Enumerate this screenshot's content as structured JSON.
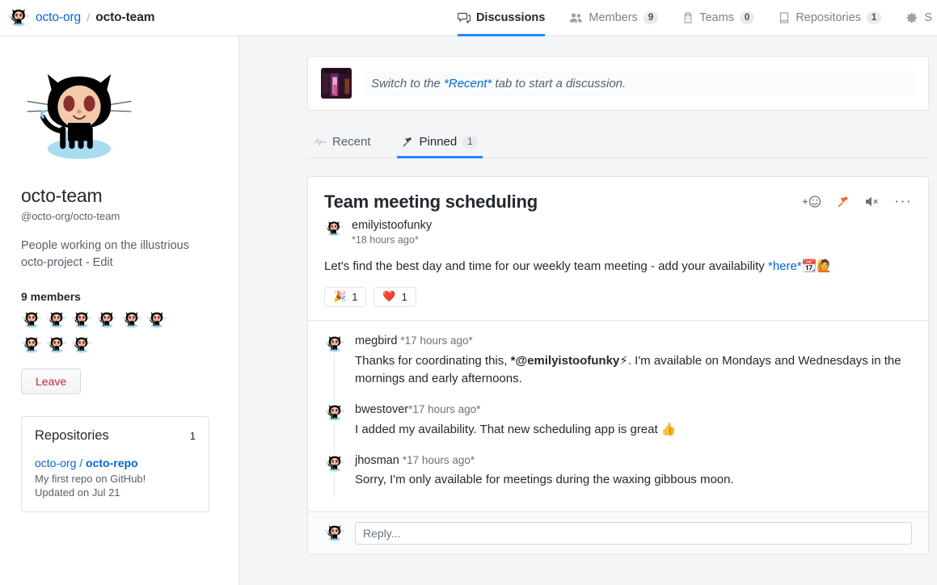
{
  "header": {
    "breadcrumb": {
      "org": "octo-org",
      "separator": "/",
      "team": "octo-team"
    },
    "tabs": [
      {
        "label": "Discussions",
        "count": "",
        "icon": "comment-discussion-icon",
        "active": true
      },
      {
        "label": "Members",
        "count": "9",
        "icon": "people-icon",
        "active": false
      },
      {
        "label": "Teams",
        "count": "0",
        "icon": "organization-icon",
        "active": false
      },
      {
        "label": "Repositories",
        "count": "1",
        "icon": "repo-icon",
        "active": false
      },
      {
        "label": "S",
        "count": "",
        "icon": "gear-icon",
        "active": false
      }
    ]
  },
  "sidebar": {
    "team_name": "octo-team",
    "team_handle": "@octo-org/octo-team",
    "team_description": "People working on the illustrious octo-project - Edit",
    "members_heading": "9 members",
    "member_count": 9,
    "leave_label": "Leave",
    "repositories_card": {
      "title": "Repositories",
      "count": "1",
      "repo_owner": "octo-org",
      "repo_separator": " / ",
      "repo_name": "octo-repo",
      "repo_description": "My first repo on GitHub!",
      "repo_updated": "Updated on Jul 21"
    }
  },
  "main": {
    "composer": {
      "text_before": "Switch to the ",
      "link_text": "*Recent*",
      "text_after": " tab to start a discussion."
    },
    "sub_tabs": [
      {
        "label": "Recent",
        "count": "",
        "icon": "pulse-icon",
        "active": false
      },
      {
        "label": "Pinned",
        "count": "1",
        "icon": "pin-icon",
        "active": true
      }
    ],
    "discussion": {
      "title": "Team meeting scheduling",
      "author": "emilyistoofunky",
      "timestamp": "*18 hours ago*",
      "body_before": "Let's find the best day and time for our weekly team meeting - add your availability ",
      "body_link": "*here*",
      "body_emoji_1": "📆",
      "body_emoji_2": "🙋",
      "actions": [
        {
          "name": "add-reaction-icon",
          "label": "+"
        },
        {
          "name": "pin-icon",
          "label": ""
        },
        {
          "name": "mute-icon",
          "label": ""
        },
        {
          "name": "more-options-icon",
          "label": "···"
        }
      ],
      "reactions": [
        {
          "emoji": "🎉",
          "count": "1"
        },
        {
          "emoji": "❤️",
          "count": "1"
        }
      ],
      "comments": [
        {
          "author": "megbird",
          "timestamp": "*17 hours ago*",
          "text_before": "Thanks for coordinating this, ",
          "mention": "*@emilyistoofunky",
          "emoji": "⚡",
          "text_after": ". I'm available on Mondays and Wednesdays in the mornings and early afternoons."
        },
        {
          "author": "bwestover",
          "timestamp": "*17 hours ago*",
          "text_before": "I added my availability. That new scheduling app is great ",
          "mention": "",
          "emoji": "👍",
          "text_after": ""
        },
        {
          "author": "jhosman",
          "timestamp": "*17 hours ago*",
          "text_before": "Sorry, I'm only available for meetings during the waxing gibbous moon.",
          "mention": "",
          "emoji": "",
          "text_after": ""
        }
      ],
      "reply_placeholder": "Reply..."
    }
  },
  "colors": {
    "accent_blue": "#2188ff",
    "link_blue": "#0366d6",
    "pin_orange": "#f26522",
    "leave_red": "#cb2431",
    "main_bg": "#f4f5f7",
    "border": "#e1e4e8"
  }
}
